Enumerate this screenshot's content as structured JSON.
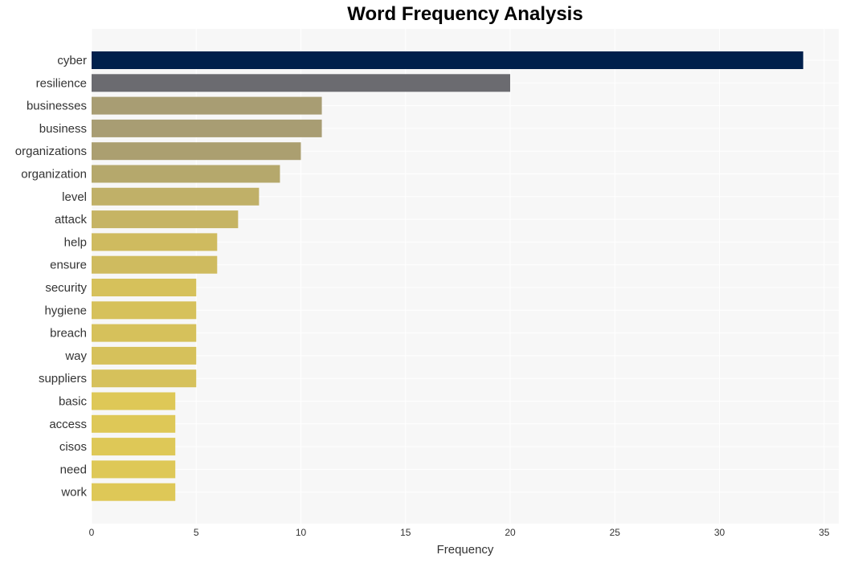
{
  "chart_data": {
    "type": "bar",
    "orientation": "horizontal",
    "title": "Word Frequency Analysis",
    "xlabel": "Frequency",
    "ylabel": "",
    "categories": [
      "cyber",
      "resilience",
      "businesses",
      "business",
      "organizations",
      "organization",
      "level",
      "attack",
      "help",
      "ensure",
      "security",
      "hygiene",
      "breach",
      "way",
      "suppliers",
      "basic",
      "access",
      "cisos",
      "need",
      "work"
    ],
    "values": [
      34,
      20,
      11,
      11,
      10,
      9,
      8,
      7,
      6,
      6,
      5,
      5,
      5,
      5,
      5,
      4,
      4,
      4,
      4,
      4
    ],
    "colors": [
      "#00204c",
      "#6b6b70",
      "#a89d73",
      "#a89d73",
      "#ab9f70",
      "#b5a86c",
      "#c0b068",
      "#c6b464",
      "#cfbb5f",
      "#cfbb5f",
      "#d6c15b",
      "#d6c15b",
      "#d6c15b",
      "#d6c15b",
      "#d6c15b",
      "#dec857",
      "#dec857",
      "#dec857",
      "#dec857",
      "#dec857"
    ],
    "xlim": [
      0,
      35.7
    ],
    "xticks": [
      0,
      5,
      10,
      15,
      20,
      25,
      30,
      35
    ],
    "grid": true,
    "legend": "none"
  }
}
